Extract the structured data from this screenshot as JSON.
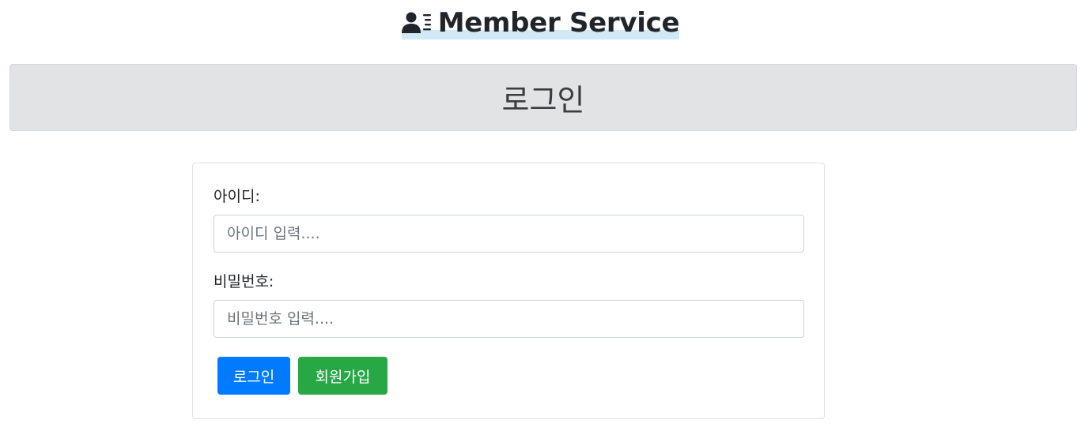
{
  "header": {
    "brand_icon": "user-list-icon",
    "title": "Member Service",
    "highlight_color": "#cfe9f7"
  },
  "banner": {
    "title": "로그인",
    "background": "#e2e3e5"
  },
  "form": {
    "id_label": "아이디:",
    "id_placeholder": "아이디 입력....",
    "id_value": "",
    "pw_label": "비밀번호:",
    "pw_placeholder": "비밀번호 입력....",
    "pw_value": "",
    "login_button": "로그인",
    "signup_button": "회원가입"
  },
  "colors": {
    "primary": "#007bff",
    "success": "#28a745"
  }
}
